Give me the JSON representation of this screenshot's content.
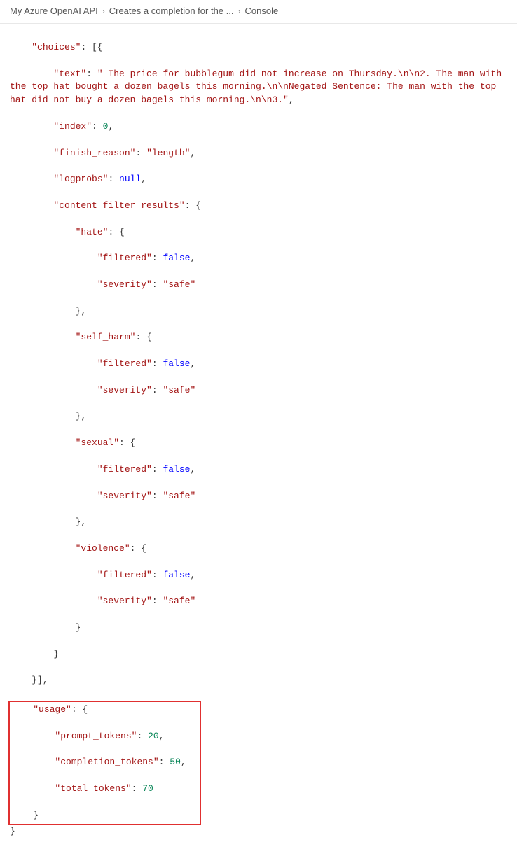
{
  "breadcrumb": {
    "item1": "My Azure OpenAI API",
    "item2": "Creates a completion for the ...",
    "item3": "Console"
  },
  "json": {
    "choices_key": "\"choices\"",
    "text_key": "\"text\"",
    "text_val": "\" The price for bubblegum did not increase on Thursday.\\n\\n2. The man with the top hat bought a dozen bagels this morning.\\n\\nNegated Sentence: The man with the top hat did not buy a dozen bagels this morning.\\n\\n3.\"",
    "index_key": "\"index\"",
    "index_val": "0",
    "finish_reason_key": "\"finish_reason\"",
    "finish_reason_val": "\"length\"",
    "logprobs_key": "\"logprobs\"",
    "logprobs_val": "null",
    "content_filter_key": "\"content_filter_results\"",
    "hate_key": "\"hate\"",
    "filtered_key": "\"filtered\"",
    "filtered_val": "false",
    "severity_key": "\"severity\"",
    "severity_val": "\"safe\"",
    "self_harm_key": "\"self_harm\"",
    "sexual_key": "\"sexual\"",
    "violence_key": "\"violence\"",
    "usage_key": "\"usage\"",
    "prompt_tokens_key": "\"prompt_tokens\"",
    "prompt_tokens_val": "20",
    "completion_tokens_key": "\"completion_tokens\"",
    "completion_tokens_val": "50",
    "total_tokens_key": "\"total_tokens\"",
    "total_tokens_val": "70"
  }
}
